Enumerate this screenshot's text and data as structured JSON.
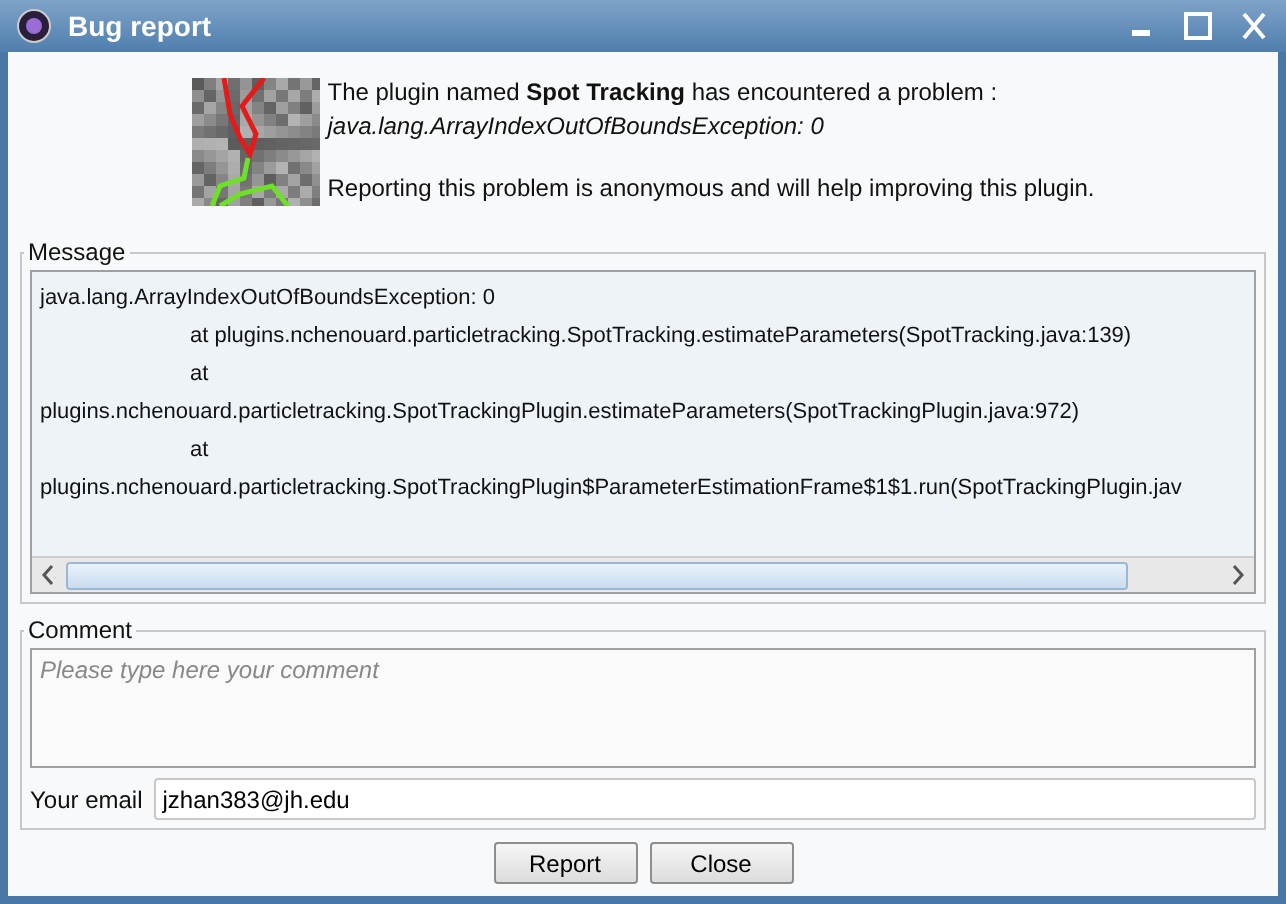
{
  "window": {
    "title": "Bug report"
  },
  "header": {
    "intro_before": "The plugin named ",
    "plugin_name": "Spot Tracking",
    "intro_after": " has encountered a problem :",
    "exception": "java.lang.ArrayIndexOutOfBoundsException: 0",
    "note": "Reporting this problem is anonymous and will help improving this plugin."
  },
  "message": {
    "legend": "Message",
    "lines": [
      "java.lang.ArrayIndexOutOfBoundsException: 0",
      "\tat plugins.nchenouard.particletracking.SpotTracking.estimateParameters(SpotTracking.java:139)",
      "\tat",
      "plugins.nchenouard.particletracking.SpotTrackingPlugin.estimateParameters(SpotTrackingPlugin.java:972)",
      "\tat",
      "plugins.nchenouard.particletracking.SpotTrackingPlugin$ParameterEstimationFrame$1$1.run(SpotTrackingPlugin.jav"
    ]
  },
  "comment": {
    "legend": "Comment",
    "placeholder": "Please type here your comment",
    "email_label": "Your email",
    "email": "jzhan383@jh.edu"
  },
  "buttons": [
    "Report",
    "Close"
  ]
}
